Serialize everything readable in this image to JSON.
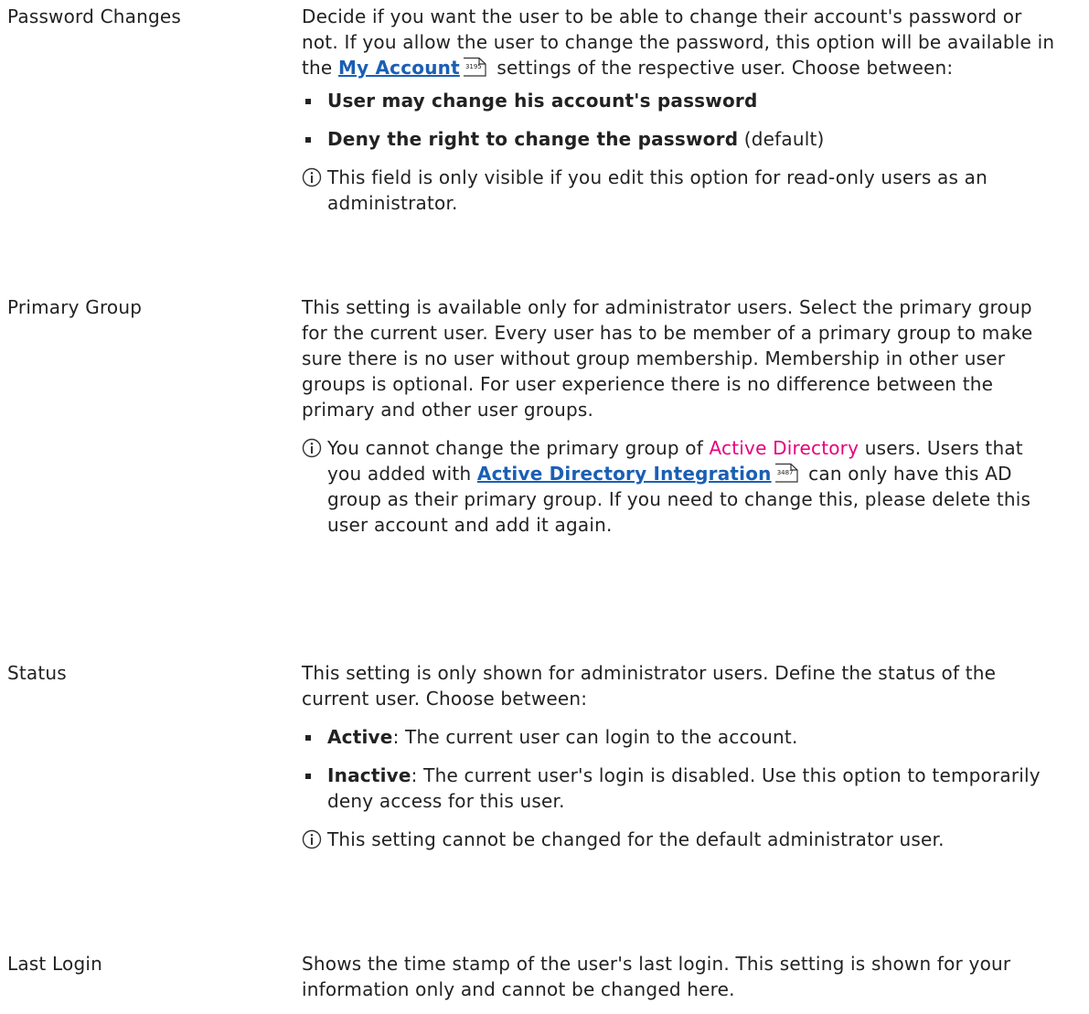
{
  "rows": [
    {
      "term": "Password Changes",
      "p1": {
        "before": "Decide if you want the user to be able to change their account's password or not. If you allow the user to change the password, this option will be available in the ",
        "link": "My Account",
        "pageref": "3195",
        "after": " settings of the respective user. Choose between:"
      },
      "options": [
        {
          "label": "User may change his account's password",
          "suffix": ""
        },
        {
          "label": "Deny the right to change the password",
          "suffix": " (default)"
        }
      ],
      "note": "This field is only visible if you edit this option for read-only users as an administrator."
    },
    {
      "term": "Primary Group",
      "p1": "This setting is available only for administrator users. Select the primary group for the current user. Every user has to be member of a primary group to make sure there is no user without group membership. Membership in other user groups is optional. For user experience there is no difference between the primary and other user groups.",
      "note": {
        "before": "You cannot change the primary group of ",
        "highlight": "Active Directory",
        "middle": " users. Users that you added with ",
        "link": "Active Directory Integration",
        "pageref": "3487",
        "after": " can only have this AD group as their primary group. If you need to change this, please delete this user account and add it again."
      }
    },
    {
      "term": "Status",
      "p1": "This setting is only shown for administrator users. Define the status of the current user. Choose between:",
      "options": [
        {
          "label": "Active",
          "text": ": The current user can login to the account."
        },
        {
          "label": "Inactive",
          "text": ": The current user's login is disabled. Use this option to temporarily deny access for this user."
        }
      ],
      "note": "This setting cannot be changed for the default administrator user."
    },
    {
      "term": "Last Login",
      "p1": "Shows the time stamp of the user's last login. This setting is shown for your information only and cannot be changed here."
    }
  ]
}
